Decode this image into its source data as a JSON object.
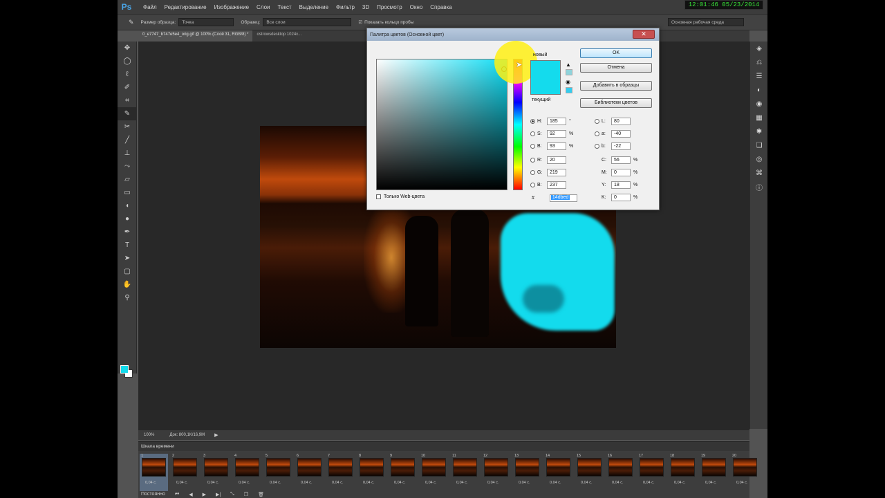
{
  "app": {
    "logo": "Ps"
  },
  "menu": [
    "Файл",
    "Редактирование",
    "Изображение",
    "Слои",
    "Текст",
    "Выделение",
    "Фильтр",
    "3D",
    "Просмотр",
    "Окно",
    "Справка"
  ],
  "clock": "12:01:46  05/23/2014",
  "options": {
    "sample_size_label": "Размер образца:",
    "sample_size_value": "Точка",
    "sample_label": "Образец:",
    "sample_value": "Все слои",
    "show_ring_label": "Показать кольцо пробы",
    "workspace": "Основная рабочая среда"
  },
  "doc_tabs": [
    "0_e7747_b747e5e4_orig.gif @ 100% (Слой 31, RGB/8) *",
    "ostrowsdesktop 1024х..."
  ],
  "status": {
    "zoom": "100%",
    "doc": "Док: 800,1K/16,9M"
  },
  "timeline": {
    "title": "Шкала времени",
    "frame_delay": "0,04 с.",
    "loop": "Постоянно",
    "frames": [
      "1",
      "2",
      "3",
      "4",
      "5",
      "6",
      "7",
      "8",
      "9",
      "10",
      "11",
      "12",
      "13",
      "14",
      "15",
      "16",
      "17",
      "18",
      "19",
      "20"
    ]
  },
  "dialog": {
    "title": "Палитра цветов (Основной цвет)",
    "close": "✕",
    "new_label": "новый",
    "current_label": "текущий",
    "buttons": {
      "ok": "OK",
      "cancel": "Отмена",
      "add_swatch": "Добавить в образцы",
      "libraries": "Библиотеки цветов"
    },
    "hsb": [
      {
        "label": "H:",
        "value": "185",
        "unit": "°"
      },
      {
        "label": "S:",
        "value": "92",
        "unit": "%"
      },
      {
        "label": "B:",
        "value": "93",
        "unit": "%"
      }
    ],
    "rgb": [
      {
        "label": "R:",
        "value": "20"
      },
      {
        "label": "G:",
        "value": "219"
      },
      {
        "label": "B:",
        "value": "237"
      }
    ],
    "lab": [
      {
        "label": "L:",
        "value": "80"
      },
      {
        "label": "a:",
        "value": "-40"
      },
      {
        "label": "b:",
        "value": "-22"
      }
    ],
    "cmyk": [
      {
        "label": "C:",
        "value": "56",
        "unit": "%"
      },
      {
        "label": "M:",
        "value": "0",
        "unit": "%"
      },
      {
        "label": "Y:",
        "value": "18",
        "unit": "%"
      },
      {
        "label": "K:",
        "value": "0",
        "unit": "%"
      }
    ],
    "web_only": "Только Web-цвета",
    "hex_label": "#",
    "hex_value": "14dbed"
  },
  "colors": {
    "foreground": "#14dbed",
    "hue": "#10def5"
  }
}
